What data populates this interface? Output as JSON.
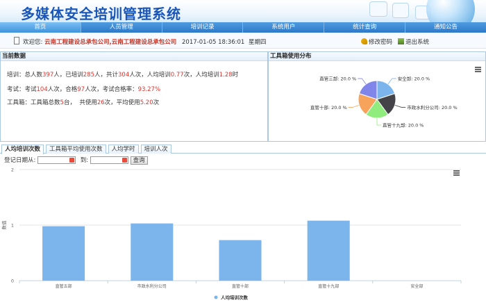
{
  "app": {
    "title": "多媒体安全培训管理系统"
  },
  "nav": {
    "items": [
      "首页",
      "人员管理",
      "培训记录",
      "系统用户",
      "统计查询",
      "通知公告"
    ]
  },
  "welcome": {
    "prefix": "欢迎您: ",
    "org": "云南工程建设总承包公司,云南工程建设总承包公司",
    "datetime": "2017-01-05 18:36:01",
    "weekday": "星期四",
    "change_password": "修改密码",
    "logout": "退出系统"
  },
  "current": {
    "title": "当前数据",
    "train": {
      "p1": "培训：总人数",
      "total": "397",
      "p2": "人，已培训",
      "trained": "285",
      "p3": "人，共计",
      "times": "304",
      "p4": "人次，人均培训",
      "avg": "0.77",
      "p5": "次，人均培训",
      "hours": "1.28",
      "p6": "时"
    },
    "exam": {
      "p1": "考试：考试",
      "count": "104",
      "p2": "人次，合格",
      "pass": "97",
      "p3": "人次，考试合格率：",
      "rate": "93.27%"
    },
    "toolbox": {
      "p1": "工具箱：工具箱总数",
      "total": "5",
      "p2": "台，  共使用",
      "used": "26",
      "p3": "次，平均使用",
      "avg": "5.20",
      "p4": "次"
    }
  },
  "toolbox_panel": {
    "title": "工具箱使用分布"
  },
  "tabs": [
    {
      "label": "人均培训次数"
    },
    {
      "label": "工具箱平均使用次数"
    },
    {
      "label": "人均学时"
    },
    {
      "label": "培训人次"
    }
  ],
  "filter": {
    "label": "登记日期从:",
    "to": "到:",
    "query": "查询",
    "from_value": "",
    "to_value": ""
  },
  "chart_data": [
    {
      "type": "pie",
      "slices": [
        {
          "label": "安全部",
          "value": 20.0,
          "color": "#7cb5ec"
        },
        {
          "label": "市政水利分公司",
          "value": 20.0,
          "color": "#434348"
        },
        {
          "label": "直管十九部",
          "value": 20.0,
          "color": "#90ed7d"
        },
        {
          "label": "直管十部",
          "value": 20.0,
          "color": "#f7a35c"
        },
        {
          "label": "直管三部",
          "value": 20.0,
          "color": "#8085e9"
        }
      ],
      "label_suffix": ": 20.0 %"
    },
    {
      "type": "bar",
      "categories": [
        "直管五部",
        "市政水利分公司",
        "直管十部",
        "直管十九部",
        "安全部"
      ],
      "series": [
        {
          "name": "人均培训次数",
          "values": [
            0.98,
            1.03,
            0.73,
            1.08,
            0
          ],
          "color": "#7cb5ec"
        }
      ],
      "ylabel": "数值",
      "ylim": [
        0,
        2
      ],
      "yticks": [
        "0",
        "1",
        "2"
      ]
    }
  ]
}
